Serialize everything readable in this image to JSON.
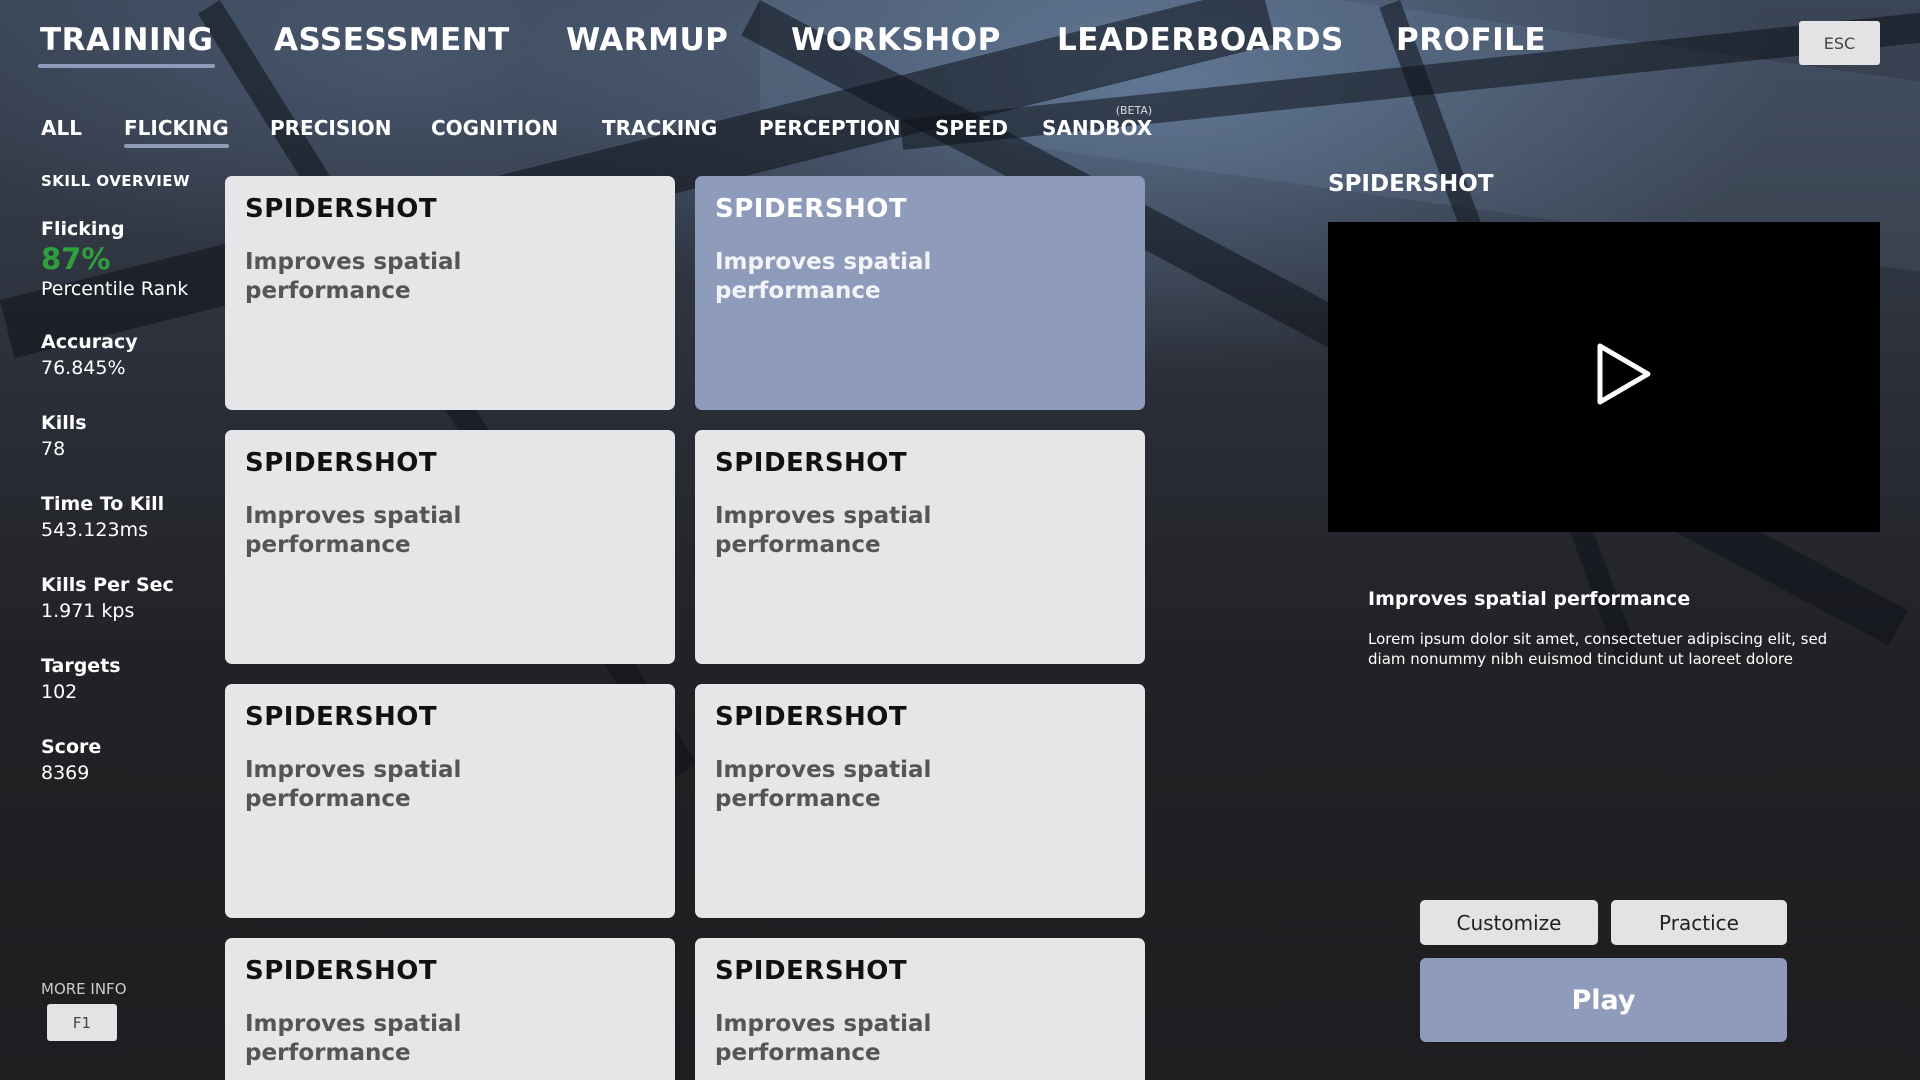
{
  "nav": {
    "items": [
      "TRAINING",
      "ASSESSMENT",
      "WARMUP",
      "WORKSHOP",
      "LEADERBOARDS",
      "PROFILE"
    ],
    "active": "TRAINING",
    "esc_label": "ESC"
  },
  "subnav": {
    "items": [
      "ALL",
      "FLICKING",
      "PRECISION",
      "COGNITION",
      "TRACKING",
      "PERCEPTION",
      "SPEED",
      "SANDBOX"
    ],
    "active": "FLICKING",
    "beta_label": "(BETA)"
  },
  "skill_overview": {
    "title": "SKILL OVERVIEW",
    "skill_name": "Flicking",
    "percentile": "87%",
    "percentile_label": "Percentile Rank",
    "stats": [
      {
        "label": "Accuracy",
        "value": "76.845%"
      },
      {
        "label": "Kills",
        "value": "78"
      },
      {
        "label": "Time To Kill",
        "value": "543.123ms"
      },
      {
        "label": "Kills Per Sec",
        "value": "1.971 kps"
      },
      {
        "label": "Targets",
        "value": "102"
      },
      {
        "label": "Score",
        "value": "8369"
      }
    ],
    "more_info_label": "MORE INFO",
    "f1_label": "F1"
  },
  "cards": [
    {
      "title": "SPIDERSHOT",
      "desc": "Improves spatial performance",
      "selected": false
    },
    {
      "title": "SPIDERSHOT",
      "desc": "Improves spatial performance",
      "selected": true
    },
    {
      "title": "SPIDERSHOT",
      "desc": "Improves spatial performance",
      "selected": false
    },
    {
      "title": "SPIDERSHOT",
      "desc": "Improves spatial performance",
      "selected": false
    },
    {
      "title": "SPIDERSHOT",
      "desc": "Improves spatial performance",
      "selected": false
    },
    {
      "title": "SPIDERSHOT",
      "desc": "Improves spatial performance",
      "selected": false
    },
    {
      "title": "SPIDERSHOT",
      "desc": "Improves spatial performance",
      "selected": false
    },
    {
      "title": "SPIDERSHOT",
      "desc": "Improves spatial performance",
      "selected": false
    }
  ],
  "detail": {
    "title": "SPIDERSHOT",
    "heading": "Improves spatial performance",
    "description": "Lorem ipsum dolor sit amet, consectetuer adipiscing elit, sed diam nonummy nibh euismod tincidunt ut laoreet dolore",
    "customize_label": "Customize",
    "practice_label": "Practice",
    "play_label": "Play",
    "video_icon": "play-icon"
  },
  "colors": {
    "accent": "#8f9bba",
    "percent_green": "#2f9e3d",
    "card_bg": "#e6e6e8",
    "background": "#1e1e21"
  }
}
